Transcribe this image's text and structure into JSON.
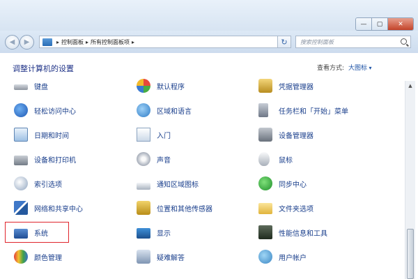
{
  "window": {
    "caption": {
      "minimize": "—",
      "maximize": "▢",
      "close": "✕"
    }
  },
  "navbar": {
    "back_glyph": "◀",
    "forward_glyph": "▶",
    "breadcrumbs": [
      "控制面板",
      "所有控制面板项"
    ],
    "separator": "▸",
    "dropdown_glyph": "▾",
    "refresh_glyph": "↻",
    "search_placeholder": "搜索控制面板"
  },
  "header": {
    "title": "调整计算机的设置",
    "view_by_label": "查看方式:",
    "view_by_value": "大图标"
  },
  "items": {
    "col1": [
      "键盘",
      "轻松访问中心",
      "日期和时间",
      "设备和打印机",
      "索引选项",
      "网络和共享中心",
      "系统",
      "颜色管理"
    ],
    "col2": [
      "默认程序",
      "区域和语言",
      "入门",
      "声音",
      "通知区域图标",
      "位置和其他传感器",
      "显示",
      "疑难解答"
    ],
    "col3": [
      "凭据管理器",
      "任务栏和「开始」菜单",
      "设备管理器",
      "鼠标",
      "同步中心",
      "文件夹选项",
      "性能信息和工具",
      "用户帐户"
    ]
  },
  "highlighted_item": "系统",
  "colors": {
    "highlight_border": "#e0242c",
    "link_text": "#1a3f8c",
    "title_text": "#1e3287"
  },
  "scrollbar": {
    "up_glyph": "▲"
  }
}
